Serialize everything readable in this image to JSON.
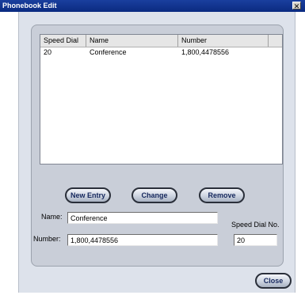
{
  "window": {
    "title": "Phonebook Edit",
    "close_glyph": "✕"
  },
  "list": {
    "columns": [
      "Speed Dial",
      "Name",
      "Number"
    ],
    "rows": [
      {
        "speed_dial": "20",
        "name": "Conference",
        "number": "1,800,4478556"
      }
    ]
  },
  "buttons": {
    "new_entry": "New Entry",
    "change": "Change",
    "remove": "Remove",
    "close": "Close"
  },
  "form": {
    "name_label": "Name:",
    "name_value": "Conference",
    "number_label": "Number:",
    "number_value": "1,800,4478556",
    "speed_dial_label": "Speed Dial No.",
    "speed_dial_value": "20"
  }
}
